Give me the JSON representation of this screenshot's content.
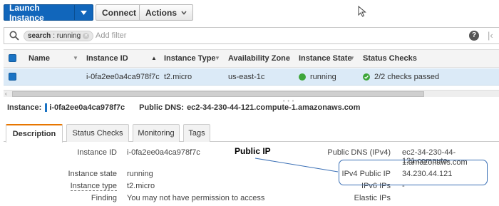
{
  "toolbar": {
    "launch_label": "Launch Instance",
    "connect_label": "Connect",
    "actions_label": "Actions"
  },
  "search": {
    "token_key": "search",
    "token_value": ": running",
    "placeholder": "Add filter"
  },
  "table": {
    "headers": {
      "name": "Name",
      "instance_id": "Instance ID",
      "instance_type": "Instance Type",
      "availability_zone": "Availability Zone",
      "instance_state": "Instance State",
      "status_checks": "Status Checks"
    },
    "rows": [
      {
        "name": "",
        "instance_id": "i-0fa2ee0a4ca978f7c",
        "instance_type": "t2.micro",
        "availability_zone": "us-east-1c",
        "instance_state": "running",
        "status_checks": "2/2 checks passed"
      }
    ]
  },
  "detail": {
    "instance_label": "Instance:",
    "instance_id": "i-0fa2ee0a4ca978f7c",
    "public_dns_label": "Public DNS:",
    "public_dns": "ec2-34-230-44-121.compute-1.amazonaws.com",
    "tabs": [
      "Description",
      "Status Checks",
      "Monitoring",
      "Tags"
    ],
    "left_fields": [
      {
        "label": "Instance ID",
        "value": "i-0fa2ee0a4ca978f7c"
      },
      {
        "label": "Instance state",
        "value": "running"
      },
      {
        "label": "Instance type",
        "value": "t2.micro"
      },
      {
        "label": "Finding",
        "value": "You may not have permission to access"
      }
    ],
    "right_fields": {
      "public_dns_label": "Public DNS (IPv4)",
      "public_dns_line1": "ec2-34-230-44-121.compute-",
      "public_dns_line2": "1.amazonaws.com",
      "ipv4_label": "IPv4 Public IP",
      "ipv4_value": "34.230.44.121",
      "ipv6_label": "IPv6 IPs",
      "ipv6_value": "-",
      "elastic_label": "Elastic IPs"
    }
  },
  "annotation": {
    "title": "Public IP"
  },
  "colors": {
    "primary": "#1166bb",
    "running_green": "#3ea63a",
    "active_tab_accent": "#e77600",
    "selected_row": "#dbeaf7",
    "annotation_blue": "#3a6fb5"
  }
}
